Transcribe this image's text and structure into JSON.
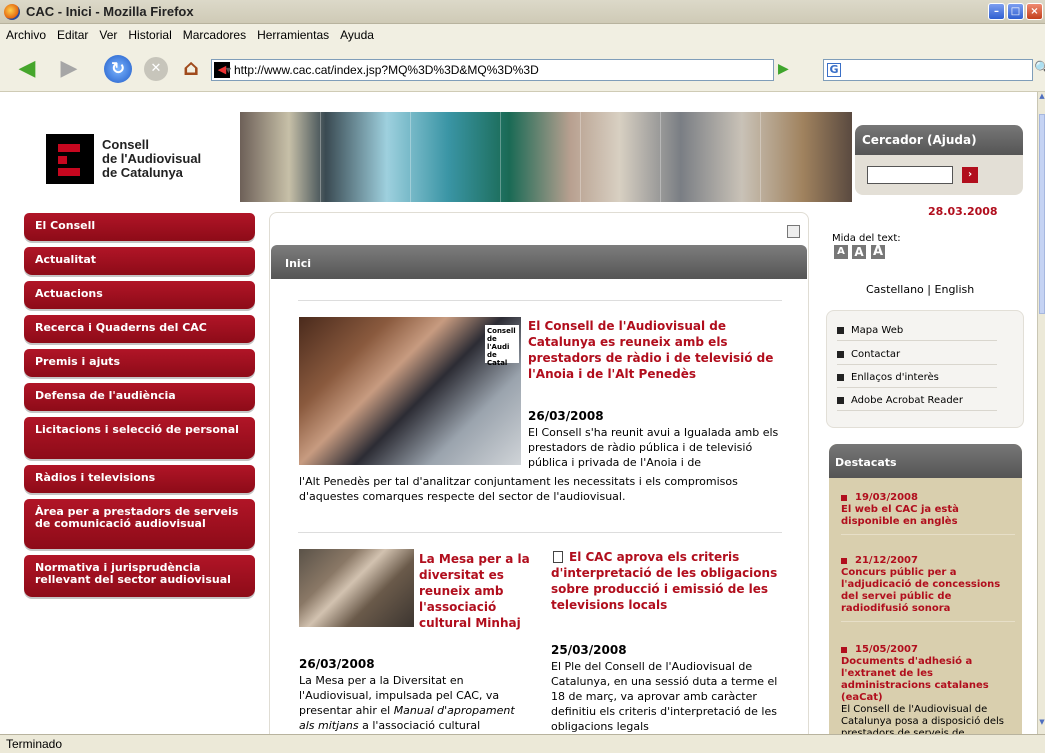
{
  "window": {
    "title": "CAC - Inici - Mozilla Firefox"
  },
  "menu": [
    "Archivo",
    "Editar",
    "Ver",
    "Historial",
    "Marcadores",
    "Herramientas",
    "Ayuda"
  ],
  "address": {
    "url": "http://www.cac.cat/index.jsp?MQ%3D%3D&MQ%3D%3D",
    "search_engine": "G"
  },
  "status": "Terminado",
  "logo": {
    "line1": "Consell",
    "line2": "de l'Audiovisual",
    "line3": "de Catalunya"
  },
  "search": {
    "title": "Cercador (Ajuda)",
    "value": ""
  },
  "date": "28.03.2008",
  "leftnav": [
    "El Consell",
    "Actualitat",
    "Actuacions",
    "Recerca i Quaderns del CAC",
    "Premis i ajuts",
    "Defensa de l'audiència",
    "Licitacions i selecció de personal",
    "Ràdios i televisions",
    "Àrea per a prestadors de serveis de comunicació audiovisual",
    "Normativa i jurisprudència rellevant del sector audiovisual"
  ],
  "center": {
    "header": "Inici",
    "news1": {
      "image_caption": "Consell de l'Audi de Catal",
      "title": "El Consell de l'Audiovisual de Catalunya es reuneix amb els prestadors de ràdio i de televisió de l'Anoia i de l'Alt Penedès",
      "date": "26/03/2008",
      "body_a": "El Consell s'ha reunit avui a Igualada amb els prestadors de ràdio pública i de televisió pública i privada de l'Anoia i de",
      "body_b": "l'Alt Penedès per tal d'analitzar conjuntament les necessitats i els compromisos d'aquestes comarques respecte del sector de l'audiovisual."
    },
    "news2": {
      "title": "La Mesa per a la diversitat es reuneix amb l'associació cultural Minhaj",
      "date": "26/03/2008",
      "body_start": "La Mesa per a la Diversitat en l'Audiovisual, impulsada pel CAC, va presentar ahir el ",
      "body_italic": "Manual d'apropament als mitjans",
      "body_end": " a l'associació cultural"
    },
    "news3": {
      "title": "El CAC aprova els criteris d'interpretació de les obligacions sobre producció i emissió de les televisions locals",
      "date": "25/03/2008",
      "body": "El Ple del Consell de l'Audiovisual de Catalunya, en una sessió duta a terme el 18 de març, va aprovar amb caràcter definitiu els criteris d'interpretació de les obligacions legals"
    }
  },
  "right": {
    "text_size_label": "Mida del text:",
    "text_size_buttons": [
      "A",
      "A",
      "A"
    ],
    "languages": [
      "Castellano",
      "|",
      "English"
    ],
    "links": [
      "Mapa Web",
      "Contactar",
      "Enllaços d'interès",
      "Adobe Acrobat Reader"
    ],
    "featured_title": "Destacats",
    "featured": [
      {
        "date": "19/03/2008",
        "title": "El web el CAC ja està disponible en anglès",
        "body": ""
      },
      {
        "date": "21/12/2007",
        "title": "Concurs públic per a l'adjudicació de concessions del servei públic de radiodifusió sonora",
        "body": ""
      },
      {
        "date": "15/05/2007",
        "title": "Documents d'adhesió a l'extranet de les administracions catalanes (eaCat)",
        "body": "El Consell de l'Audiovisual de Catalunya posa a disposició dels prestadors de serveis de"
      }
    ]
  },
  "colors": {
    "brand_red": "#b10e1d",
    "nav_red": "#a3101f",
    "header_gray": "#666666",
    "featured_bg": "#d9cfae"
  },
  "icons": [
    "firefox-icon",
    "back-icon",
    "forward-icon",
    "reload-icon",
    "stop-icon",
    "home-icon",
    "favicon-icon",
    "go-icon",
    "google-icon",
    "search-go-icon",
    "print-icon",
    "search-submit-icon",
    "document-icon",
    "bullet-icon"
  ]
}
